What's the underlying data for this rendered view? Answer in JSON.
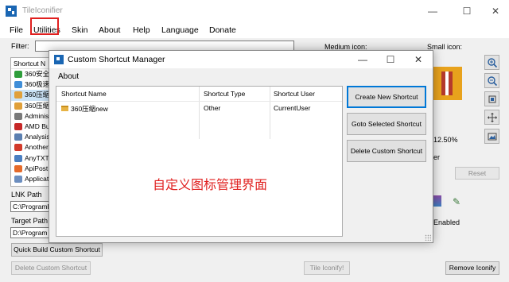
{
  "window": {
    "title": "TileIconifier",
    "minimize": "—",
    "maximize": "☐",
    "close": "✕"
  },
  "menu": [
    "File",
    "Utilities",
    "Skin",
    "About",
    "Help",
    "Language",
    "Donate"
  ],
  "filter": {
    "label": "Filter:",
    "value": ""
  },
  "shortcut_list": {
    "header": "Shortcut N",
    "items": [
      {
        "label": "360安全",
        "color": "#2f9e3c",
        "selected": false
      },
      {
        "label": "360极速",
        "color": "#3f8ed8",
        "selected": false
      },
      {
        "label": "360压缩",
        "color": "#e0a03a",
        "selected": true
      },
      {
        "label": "360压缩",
        "color": "#e0a03a",
        "selected": false
      },
      {
        "label": "Adminis",
        "color": "#7a7a7a",
        "selected": false
      },
      {
        "label": "AMD Bu",
        "color": "#c62828",
        "selected": false
      },
      {
        "label": "Analysis",
        "color": "#5b7fb0",
        "selected": false
      },
      {
        "label": "Another",
        "color": "#d23a2a",
        "selected": false
      },
      {
        "label": "AnyTXT",
        "color": "#4a7fc1",
        "selected": false
      },
      {
        "label": "ApiPost",
        "color": "#e56a2a",
        "selected": false
      },
      {
        "label": "Applicat",
        "color": "#6c8ebf",
        "selected": false
      }
    ]
  },
  "lnk_path": {
    "label": "LNK Path",
    "value": "C:\\ProgramD"
  },
  "target_path": {
    "label": "Target Path",
    "value": "D:\\Program"
  },
  "buttons": {
    "quick_build": "Quick Build Custom Shortcut",
    "delete_custom": "Delete Custom Shortcut",
    "tile_iconify": "Tile Iconify!",
    "remove_iconify": "Remove Iconify",
    "reset": "Reset"
  },
  "icons_panel": {
    "medium_label": "Medium icon:",
    "small_label": "Small icon:",
    "zoom_value": "12.50%",
    "partial_label": "er",
    "enabled_label": "Enabled"
  },
  "dialog": {
    "title": "Custom Shortcut Manager",
    "menu": "About",
    "columns": [
      "Shortcut Name",
      "Shortcut Type",
      "Shortcut User"
    ],
    "rows": [
      {
        "name": "360压缩new",
        "type": "Other",
        "user": "CurrentUser"
      }
    ],
    "buttons": [
      "Create New Shortcut",
      "Goto Selected Shortcut",
      "Delete Custom Shortcut"
    ],
    "annotation": "自定义图标管理界面",
    "minimize": "—",
    "maximize": "☐",
    "close": "✕"
  },
  "colors": {
    "highlight_box": "#e0201f",
    "selection": "#cce4f7",
    "focus_border": "#0078d7",
    "annotation": "#e0201f"
  }
}
